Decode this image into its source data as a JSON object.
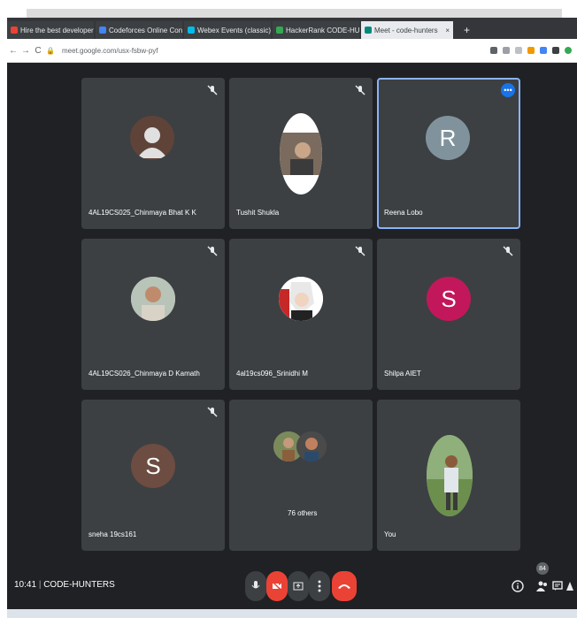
{
  "browser": {
    "tabs": [
      {
        "title": "Hire the best developers",
        "color": "#ea4335"
      },
      {
        "title": "Codeforces Online Contest a",
        "color": "#4285f4"
      },
      {
        "title": "Webex Events (classic)",
        "color": "#00bceb"
      },
      {
        "title": "HackerRank CODE-HUNTERS",
        "color": "#34a853"
      },
      {
        "title": "Meet - code-hunters",
        "color": "#00897b"
      }
    ],
    "url": "meet.google.com/usx-fsbw-pyf"
  },
  "meeting": {
    "participants": [
      {
        "name": "4AL19CS025_Chinmaya Bhat K K",
        "type": "default",
        "color": "#5f4339"
      },
      {
        "name": "Tushit Shukla",
        "type": "photo",
        "color": "#e8e0d8"
      },
      {
        "name": "Reena Lobo",
        "type": "initial",
        "initial": "R",
        "color": "#80939c"
      },
      {
        "name": "4AL19CS026_Chinmaya D Kamath",
        "type": "photo",
        "color": "#cfd9d0"
      },
      {
        "name": "4al19cs096_Srinidhi M",
        "type": "photo",
        "color": "#d8d8d8"
      },
      {
        "name": "Shilpa AIET",
        "type": "initial",
        "initial": "S",
        "color": "#c2185b"
      },
      {
        "name": "sneha 19cs161",
        "type": "initial",
        "initial": "S",
        "color": "#6d4c41"
      },
      {
        "name": "76 others",
        "type": "others",
        "color": "#3c4043"
      },
      {
        "name": "You",
        "type": "photo",
        "color": "#7aa36a"
      }
    ],
    "time": "10:41",
    "meeting_name": "CODE-HUNTERS",
    "people_count": "84"
  }
}
